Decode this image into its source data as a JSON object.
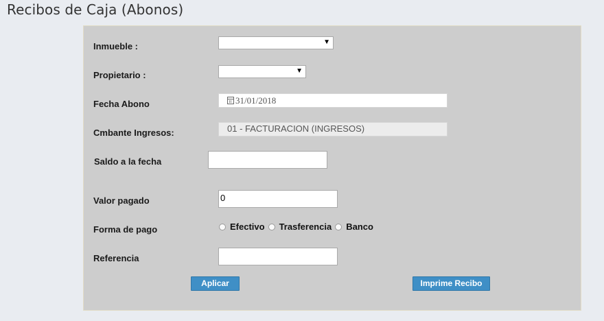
{
  "page": {
    "title": "Recibos de Caja (Abonos)"
  },
  "form": {
    "inmueble": {
      "label": "Inmueble :",
      "value": "",
      "arrow": "▼"
    },
    "propietario": {
      "label": "Propietario :",
      "value": "",
      "arrow": "▼"
    },
    "fecha_abono": {
      "label": "Fecha Abono",
      "value": "31/01/2018",
      "icon": "calendar-icon"
    },
    "cmbante_ingresos": {
      "label": "Cmbante Ingresos:",
      "value": "01 - FACTURACION (INGRESOS)"
    },
    "saldo_fecha": {
      "label": "Saldo a la fecha",
      "value": ""
    },
    "valor_pagado": {
      "label": "Valor pagado",
      "value": "0"
    },
    "forma_pago": {
      "label": "Forma de pago",
      "options": [
        "Efectivo",
        "Trasferencia",
        "Banco"
      ],
      "selected": null
    },
    "referencia": {
      "label": "Referencia",
      "value": ""
    }
  },
  "buttons": {
    "aplicar": "Aplicar",
    "imprime_recibo": "Imprime Recibo"
  },
  "colors": {
    "background": "#e9ecf1",
    "panel": "#cdcdcd",
    "button": "#3f8fc6"
  }
}
